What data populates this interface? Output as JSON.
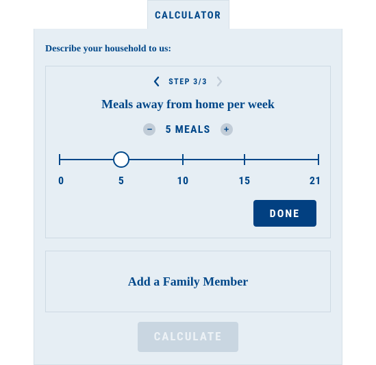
{
  "tab": {
    "label": "CALCULATOR"
  },
  "intro": "Describe your household to us:",
  "step": {
    "label": "STEP 3/3",
    "question": "Meals away from home per week",
    "value_text": "5 MEALS",
    "slider": {
      "min": 0,
      "max": 21,
      "value": 5,
      "marks": [
        0,
        5,
        10,
        15,
        21
      ]
    },
    "done_label": "DONE"
  },
  "add_member": {
    "label": "Add a Family Member"
  },
  "calculate": {
    "label": "CALCULATE"
  }
}
